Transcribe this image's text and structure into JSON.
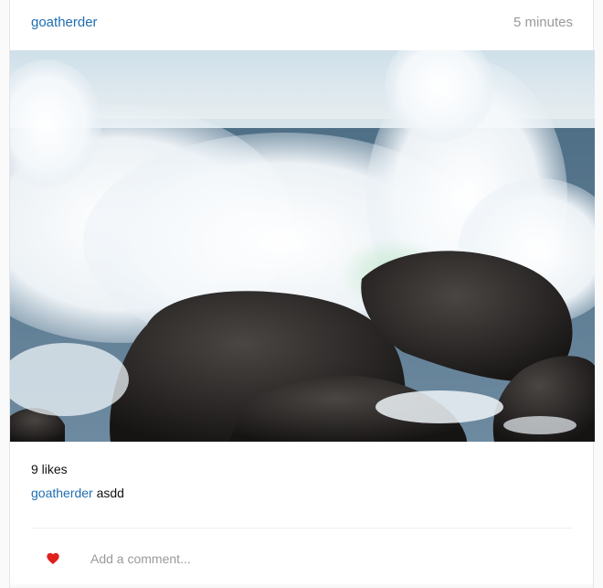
{
  "post": {
    "username": "goatherder",
    "timestamp": "5 minutes",
    "photo_alt": "Wave crashing on rocks",
    "likes_text": "9 likes",
    "caption": {
      "author": "goatherder",
      "text": "asdd"
    },
    "like_icon": "heart-icon",
    "like_color": "#e0201b",
    "comment_placeholder": "Add a comment..."
  },
  "colors": {
    "link": "#1f6fb2",
    "muted": "#9a9a9a"
  }
}
